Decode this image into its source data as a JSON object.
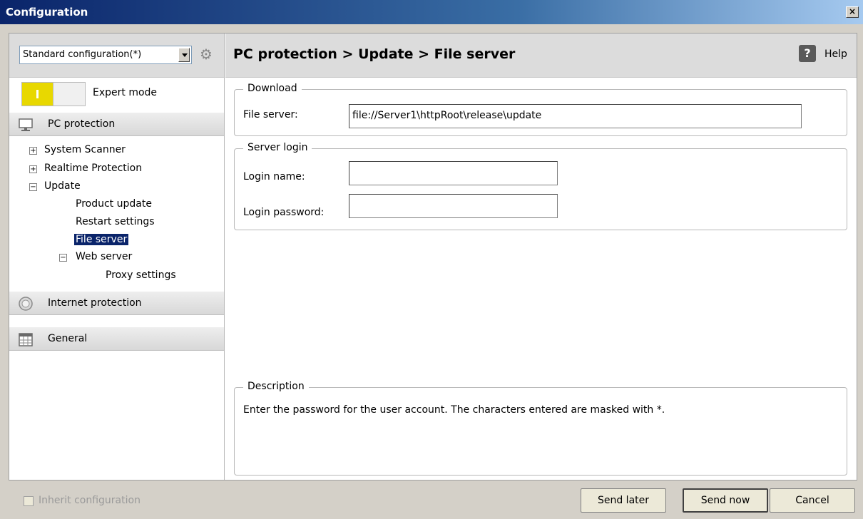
{
  "window": {
    "title": "Configuration",
    "close_label": "×"
  },
  "left": {
    "config_select": {
      "selected": "Standard configuration(*)"
    },
    "expert_mode_label": "Expert mode",
    "sections": [
      {
        "label": "PC protection"
      },
      {
        "label": "Internet protection"
      },
      {
        "label": "General"
      }
    ],
    "tree": {
      "system_scanner": "System Scanner",
      "realtime_protection": "Realtime Protection",
      "update": "Update",
      "product_update": "Product update",
      "restart_settings": "Restart settings",
      "file_server": "File server",
      "web_server": "Web server",
      "proxy_settings": "Proxy settings"
    }
  },
  "main": {
    "breadcrumb": "PC protection > Update > File server",
    "help_label": "Help",
    "download": {
      "legend": "Download",
      "file_server_label": "File server:",
      "file_server_value": "file://Server1\\httpRoot\\release\\update"
    },
    "server_login": {
      "legend": "Server login",
      "login_name_label": "Login name:",
      "login_password_label": "Login password:",
      "login_name_value": "",
      "login_password_value": ""
    },
    "description": {
      "legend": "Description",
      "text": "Enter the password for the user account. The characters entered are masked with *."
    }
  },
  "footer": {
    "inherit_label": "Inherit configuration",
    "send_later": "Send later",
    "send_now": "Send now",
    "cancel": "Cancel"
  }
}
